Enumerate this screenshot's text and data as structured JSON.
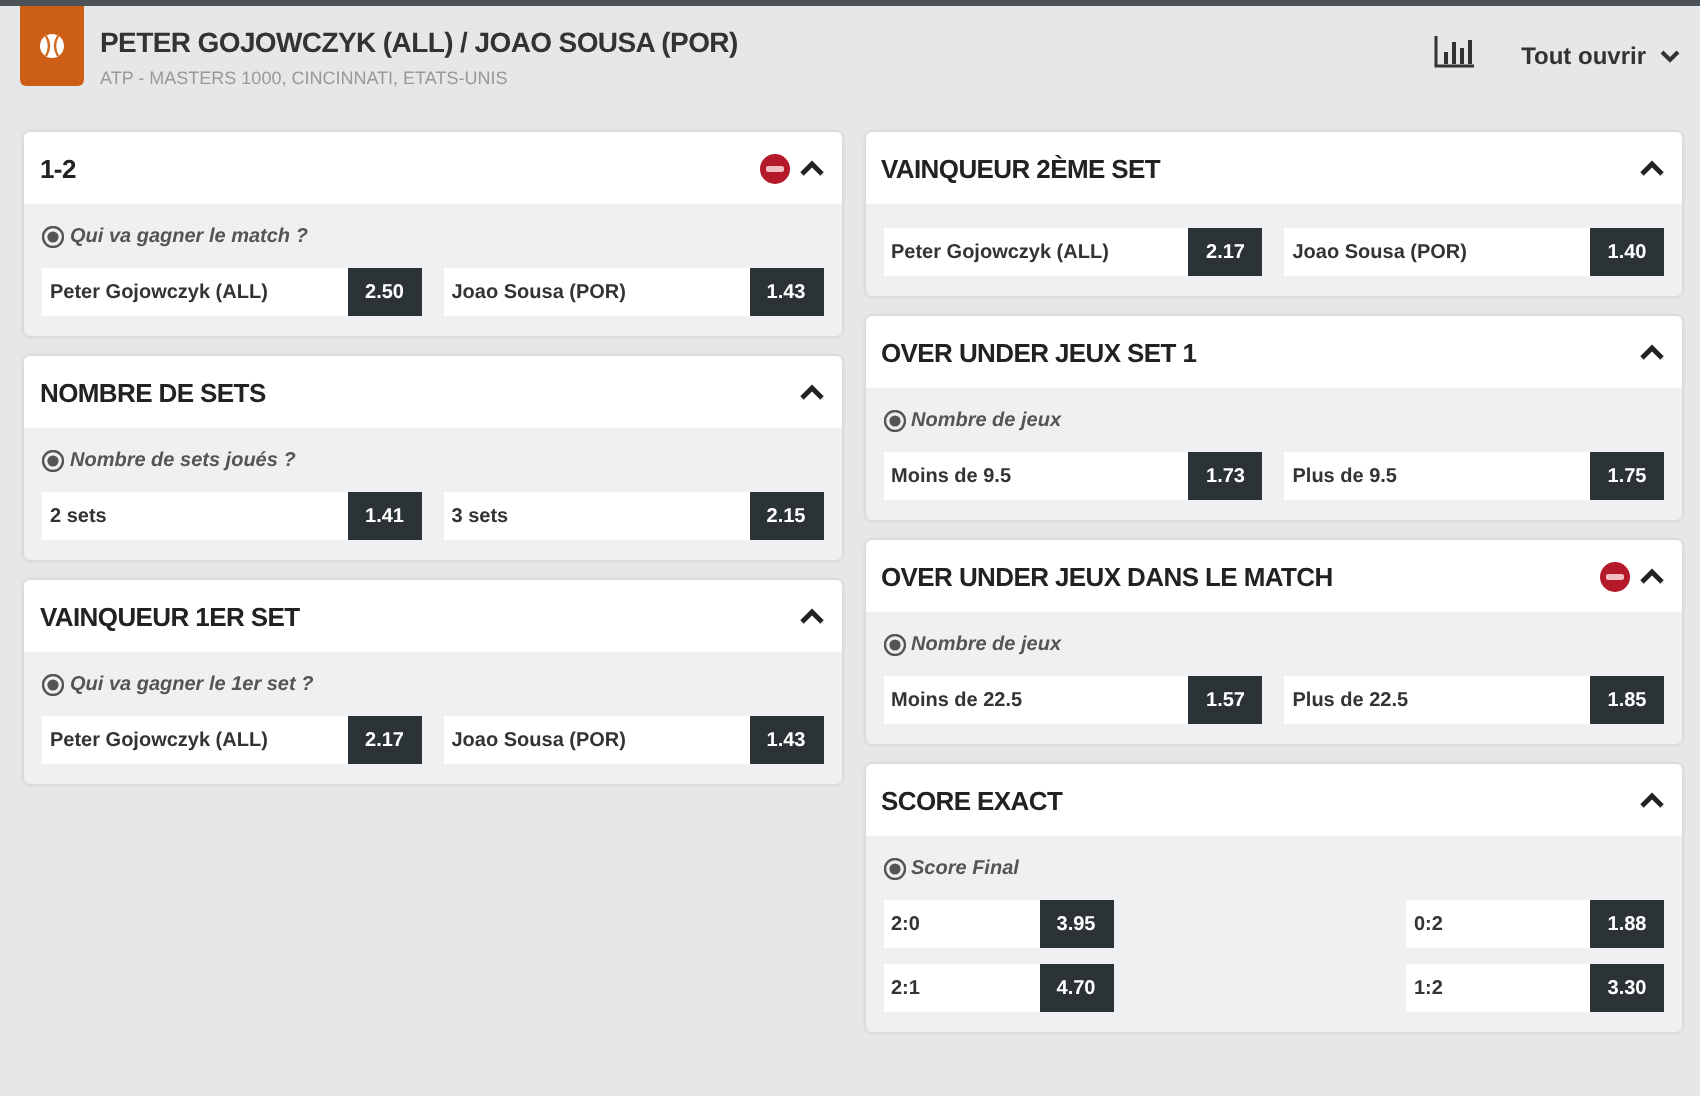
{
  "event": {
    "title": "PETER GOJOWCZYK (ALL) / JOAO SOUSA (POR)",
    "subtitle": "ATP - MASTERS 1000, CINCINNATI, ETATS-UNIS"
  },
  "toolbar": {
    "open_all": "Tout ouvrir"
  },
  "columns": [
    {
      "markets": [
        {
          "title": "1-2",
          "badge": true,
          "expanded": true,
          "kind": "pair",
          "question": "Qui va gagner le match ?",
          "outcomes": [
            {
              "label": "Peter Gojowczyk (ALL)",
              "odds": "2.50"
            },
            {
              "label": "Joao Sousa (POR)",
              "odds": "1.43"
            }
          ]
        },
        {
          "title": "NOMBRE DE SETS",
          "badge": false,
          "expanded": true,
          "kind": "pair",
          "question": "Nombre de sets joués ?",
          "outcomes": [
            {
              "label": "2 sets",
              "odds": "1.41"
            },
            {
              "label": "3 sets",
              "odds": "2.15"
            }
          ]
        },
        {
          "title": "VAINQUEUR 1ER SET",
          "badge": false,
          "expanded": true,
          "kind": "pair",
          "question": "Qui va gagner le 1er set ?",
          "outcomes": [
            {
              "label": "Peter Gojowczyk (ALL)",
              "odds": "2.17"
            },
            {
              "label": "Joao Sousa (POR)",
              "odds": "1.43"
            }
          ]
        }
      ]
    },
    {
      "markets": [
        {
          "title": "VAINQUEUR 2ÈME SET",
          "badge": false,
          "expanded": true,
          "kind": "pair",
          "outcomes": [
            {
              "label": "Peter Gojowczyk (ALL)",
              "odds": "2.17"
            },
            {
              "label": "Joao Sousa (POR)",
              "odds": "1.40"
            }
          ]
        },
        {
          "title": "OVER UNDER JEUX SET 1",
          "badge": false,
          "expanded": true,
          "kind": "pair",
          "question": "Nombre de jeux",
          "outcomes": [
            {
              "label": "Moins de 9.5",
              "odds": "1.73"
            },
            {
              "label": "Plus de 9.5",
              "odds": "1.75"
            }
          ]
        },
        {
          "title": "OVER UNDER JEUX DANS LE MATCH",
          "badge": true,
          "expanded": true,
          "kind": "pair",
          "question": "Nombre de jeux",
          "outcomes": [
            {
              "label": "Moins de 22.5",
              "odds": "1.57"
            },
            {
              "label": "Plus de 22.5",
              "odds": "1.85"
            }
          ]
        },
        {
          "title": "SCORE EXACT",
          "badge": false,
          "expanded": true,
          "kind": "score",
          "question": "Score Final",
          "outcomes": [
            {
              "label": "2:0",
              "odds": "3.95"
            },
            {
              "label": "0:2",
              "odds": "1.88"
            },
            {
              "label": "2:1",
              "odds": "4.70"
            },
            {
              "label": "1:2",
              "odds": "3.30"
            }
          ]
        }
      ]
    }
  ]
}
